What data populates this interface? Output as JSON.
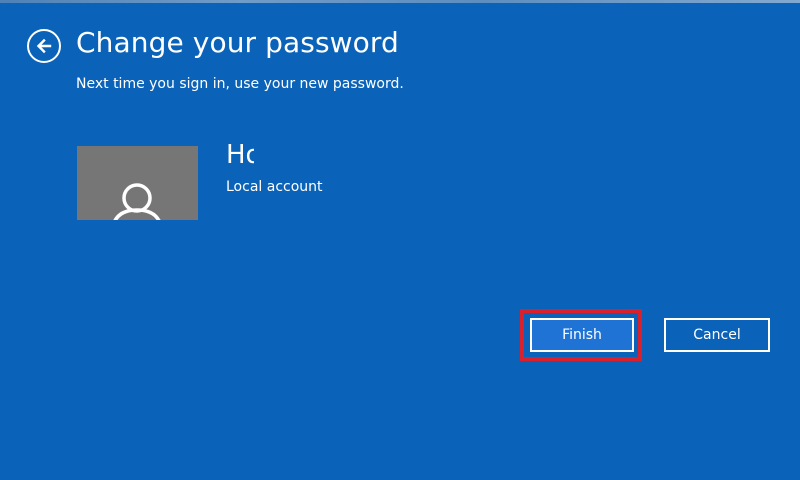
{
  "header": {
    "title": "Change your password",
    "subtitle": "Next time you sign in, use your new password.",
    "back_icon": "back-arrow-icon"
  },
  "account": {
    "name": "Ho",
    "type": "Local account",
    "avatar_icon": "user-icon"
  },
  "actions": {
    "finish_label": "Finish",
    "cancel_label": "Cancel"
  },
  "colors": {
    "background": "#0a63b8",
    "primary_button": "#1f73d4",
    "highlight": "#d9212e",
    "avatar_bg": "#767676",
    "text": "#ffffff"
  }
}
